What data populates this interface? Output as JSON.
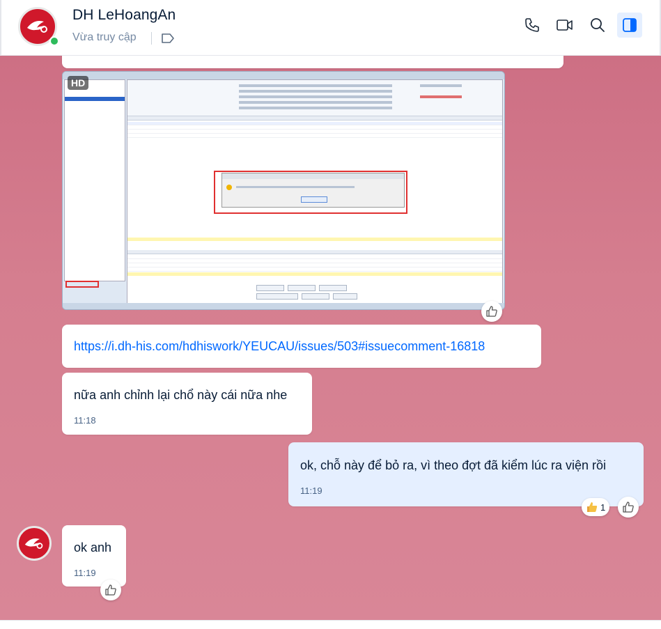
{
  "header": {
    "contact_name": "DH LeHoangAn",
    "status": "Vừa truy cập"
  },
  "messages": {
    "link_text": "https://i.dh-his.com/hdhiswork/YEUCAU/issues/503#issuecomment-16818",
    "msg1_text": "nữa anh chỉnh lại chổ này cái nữa nhe",
    "msg1_time": "11:18",
    "msg2_text": "ok, chỗ này để bỏ ra, vì theo đợt đã kiểm lúc ra viện rồi",
    "msg2_time": "11:19",
    "msg2_reaction_count": "1",
    "msg3_text": "ok anh",
    "msg3_time": "11:19"
  },
  "image": {
    "badge": "HD"
  },
  "colors": {
    "accent": "#0068ff",
    "brand_avatar": "#d0182b",
    "online": "#2ebb5c",
    "my_bubble": "#e5efff"
  },
  "icons": [
    "phone-icon",
    "video-call-icon",
    "search-icon",
    "sidebar-toggle-icon",
    "tag-icon",
    "like-icon",
    "thumbs-up-emoji-icon"
  ]
}
